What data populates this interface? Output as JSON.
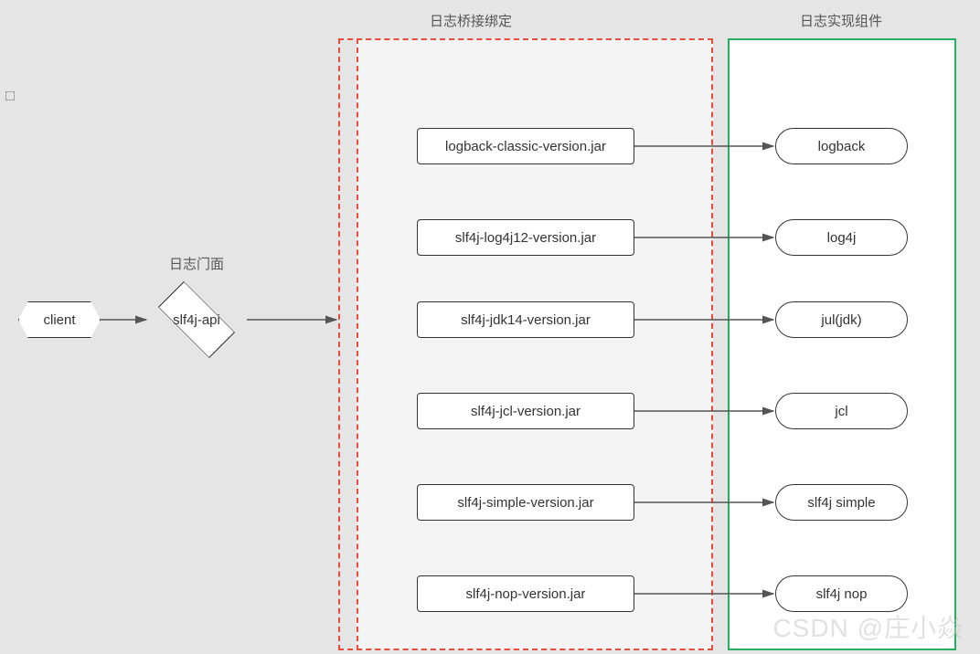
{
  "labels": {
    "facade": "日志门面",
    "bridge": "日志桥接绑定",
    "impl": "日志实现组件"
  },
  "client": "client",
  "api": "slf4j-api",
  "bridges": [
    "logback-classic-version.jar",
    "slf4j-log4j12-version.jar",
    "slf4j-jdk14-version.jar",
    "slf4j-jcl-version.jar",
    "slf4j-simple-version.jar",
    "slf4j-nop-version.jar"
  ],
  "impls": [
    "logback",
    "log4j",
    "jul(jdk)",
    "jcl",
    "slf4j simple",
    "slf4j nop"
  ],
  "watermark": "CSDN @庄小焱"
}
